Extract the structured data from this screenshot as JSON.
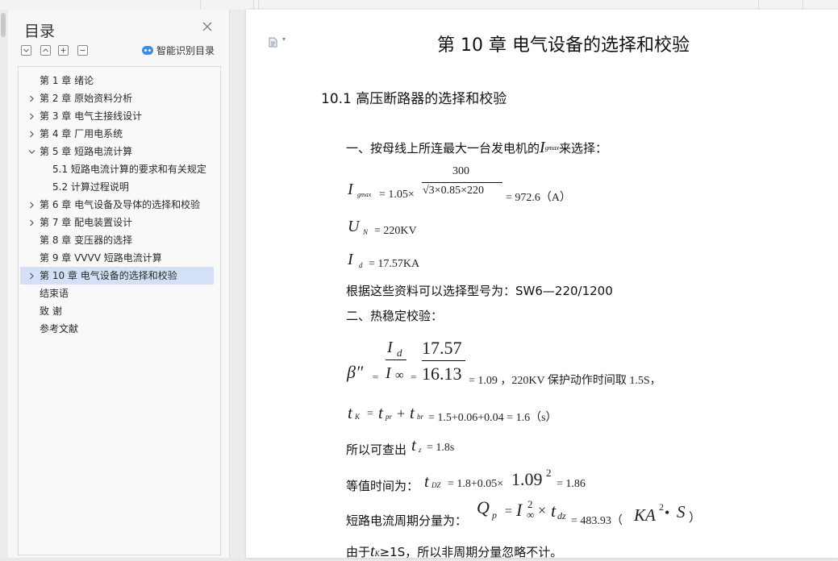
{
  "sidebar": {
    "title": "目录",
    "smart_label": "智能识别目录",
    "toc": [
      {
        "label": "第 1 章  绪论",
        "level": 1,
        "chevron": "none"
      },
      {
        "label": "第 2 章  原始资料分析",
        "level": 1,
        "chevron": "right"
      },
      {
        "label": "第 3 章  电气主接线设计",
        "level": 1,
        "chevron": "right"
      },
      {
        "label": "第 4 章  厂用电系统",
        "level": 1,
        "chevron": "right"
      },
      {
        "label": "第 5 章  短路电流计算",
        "level": 1,
        "chevron": "down"
      },
      {
        "label": "5.1  短路电流计算的要求和有关规定",
        "level": 2,
        "chevron": "none"
      },
      {
        "label": "5.2  计算过程说明",
        "level": 2,
        "chevron": "none"
      },
      {
        "label": "第 6 章  电气设备及导体的选择和校验",
        "level": 1,
        "chevron": "right"
      },
      {
        "label": "第 7 章  配电装置设计",
        "level": 1,
        "chevron": "right"
      },
      {
        "label": "第 8 章  变压器的选择",
        "level": 1,
        "chevron": "none"
      },
      {
        "label": "第 9 章  VVVV  短路电流计算",
        "level": 1,
        "chevron": "none"
      },
      {
        "label": "第 10 章  电气设备的选择和校验",
        "level": 1,
        "chevron": "right",
        "selected": true
      },
      {
        "label": "结束语",
        "level": 1,
        "chevron": "none"
      },
      {
        "label": "致    谢",
        "level": 1,
        "chevron": "none"
      },
      {
        "label": "参考文献",
        "level": 1,
        "chevron": "none"
      }
    ]
  },
  "doc": {
    "chapter_title": "第 10 章  电气设备的选择和校验",
    "section_title": "10.1  高压断路器的选择和校验",
    "line1_text_a": "一、按母线上所连最大一台发电机的",
    "line1_I": "I",
    "line1_sub": "gmax",
    "line1_text_b": "来选择：",
    "eq1_I": "I",
    "eq1_sub": "gmax",
    "eq1_lhs": "= 1.05×",
    "eq1_num": "300",
    "eq1_den": "√3×0.85×220",
    "eq1_rhs": "= 972.6（A）",
    "eq2_U": "U",
    "eq2_sub": "N",
    "eq2_rhs": "= 220KV",
    "eq3_I": "I",
    "eq3_sub": "d",
    "eq3_rhs": "= 17.57KA",
    "model_text": "根据这些资料可以选择型号为：SW6—220/1200",
    "thermal_title": "二、热稳定校验：",
    "beta": "β″",
    "beta_eq": "=",
    "beta_frac_num": "I",
    "beta_frac_num_sub": "d",
    "beta_frac_den": "I",
    "beta_frac_den_sub": "∞",
    "beta_eq2": "=",
    "beta_num": "17.57",
    "beta_den": "16.13",
    "beta_rhs": "= 1.09 ，220KV 保护动作时间取 1.5S，",
    "tk_t": "t",
    "tk_sub": "K",
    "tk_eq": "=",
    "tk_t2": "t",
    "tk_sub2": "pr",
    "tk_plus": "+",
    "tk_t3": "t",
    "tk_sub3": "br",
    "tk_rhs": "= 1.5+0.06+0.04 = 1.6（s）",
    "tz_text": "所以可查出",
    "tz_t": "t",
    "tz_sub": "z",
    "tz_rhs": "= 1.8s",
    "tdz_text": "等值时间为：",
    "tdz_t": "t",
    "tdz_sub": "DZ",
    "tdz_mid": "= 1.8+0.05×",
    "tdz_big": "1.09",
    "tdz_sup": "2",
    "tdz_rhs": "= 1.86",
    "qp_text": "短路电流周期分量为：",
    "qp_Q": "Q",
    "qp_sub": "p",
    "qp_eq": "=",
    "qp_I": "I",
    "qp_sup": "2",
    "qp_inf": "∞",
    "qp_times": "×",
    "qp_t": "t",
    "qp_tsub": "dz",
    "qp_rhs": "= 483.93（",
    "qp_unit": "KA",
    "qp_unit_sup": "2",
    "qp_dot": "•",
    "qp_S": "S",
    "qp_close": "）",
    "last_a": "由于",
    "last_t": "t",
    "last_sub": "K",
    "last_b": "≥1S，所以非周期分量忽略不计。"
  }
}
